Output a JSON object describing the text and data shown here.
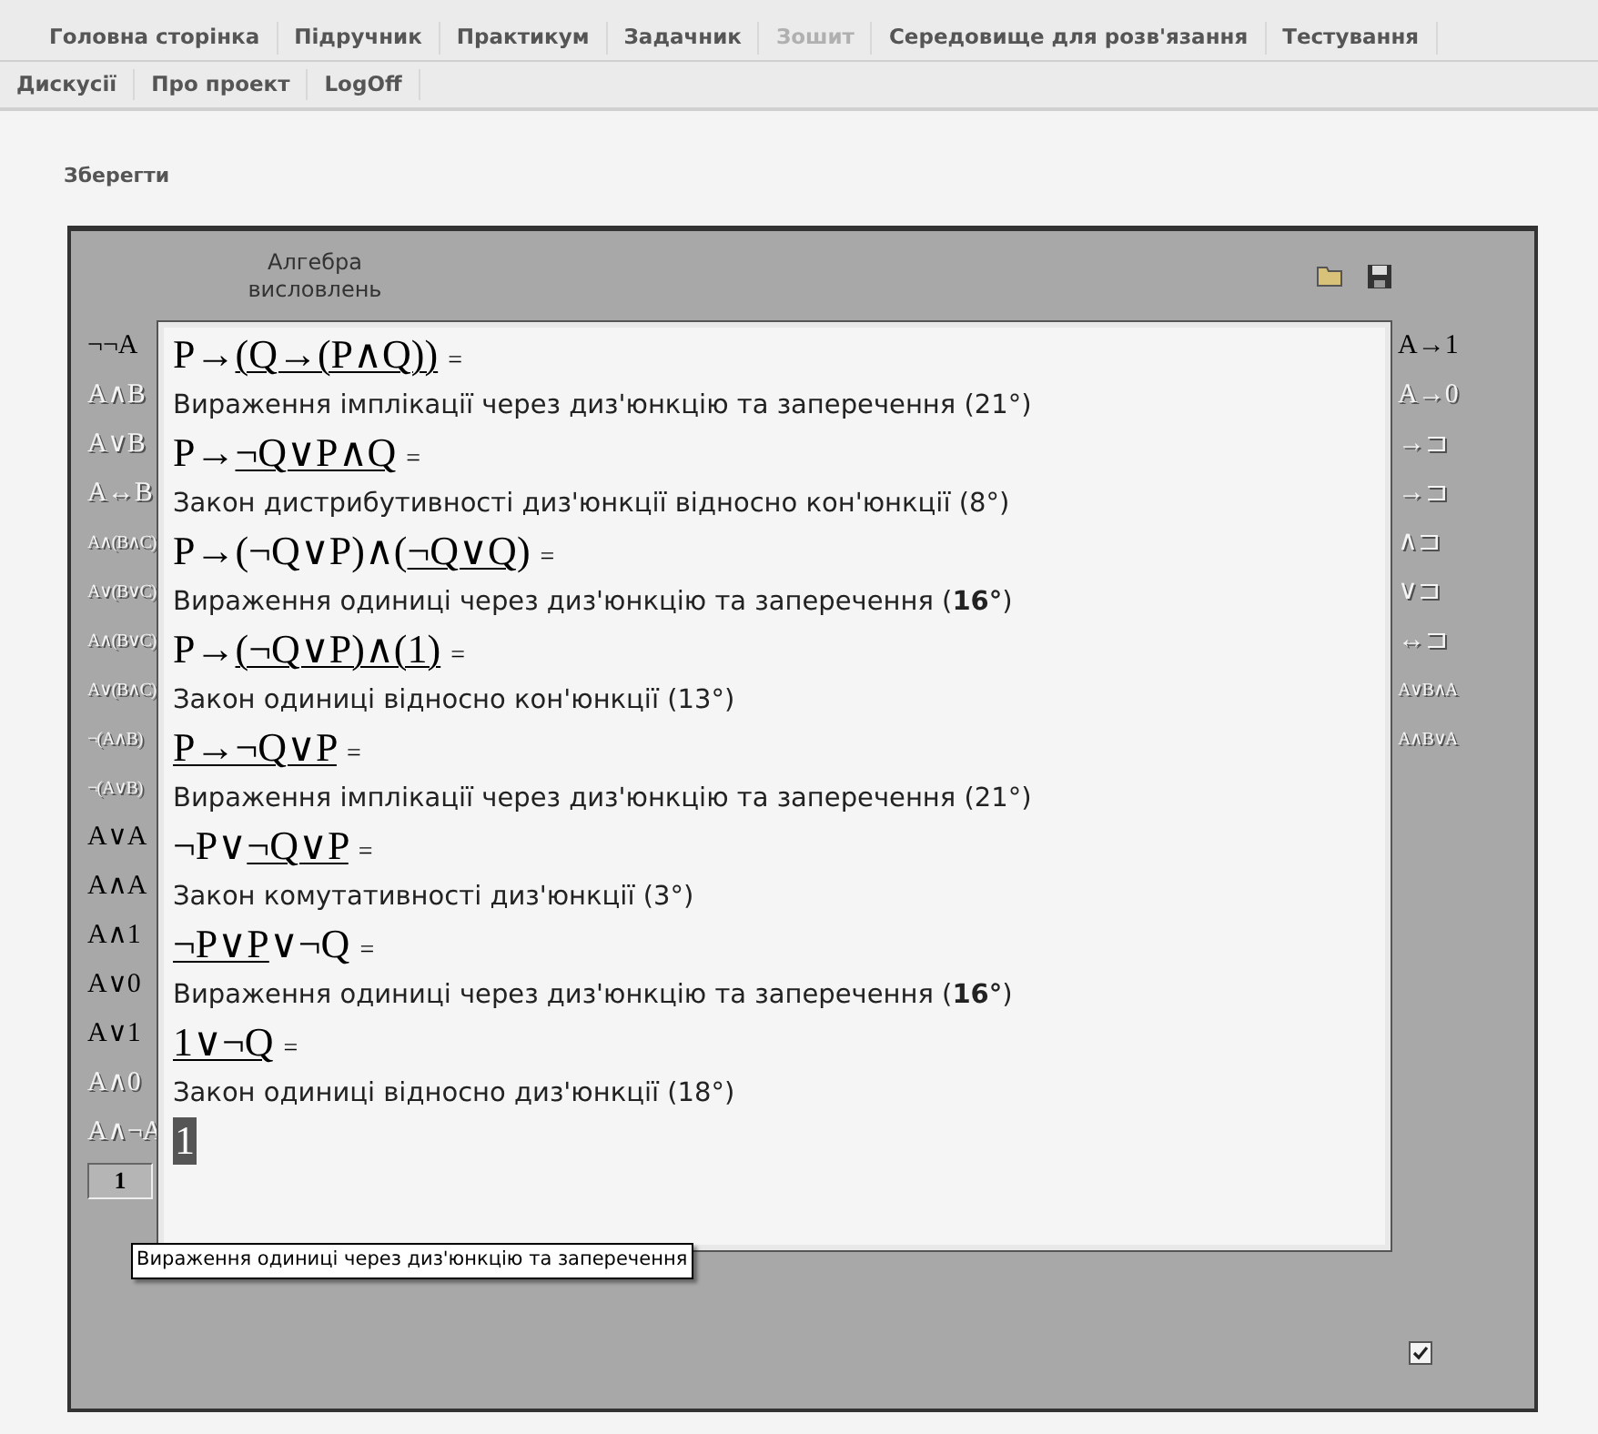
{
  "nav": {
    "main_tabs": [
      {
        "label": "Головна сторінка",
        "disabled": false
      },
      {
        "label": "Підручник",
        "disabled": false
      },
      {
        "label": "Практикум",
        "disabled": false
      },
      {
        "label": "Задачник",
        "disabled": false
      },
      {
        "label": "Зошит",
        "disabled": true
      },
      {
        "label": "Середовище для розв'язання",
        "disabled": false
      },
      {
        "label": "Тестування",
        "disabled": false
      }
    ],
    "secondary_tabs": [
      {
        "label": "Дискусії",
        "disabled": false
      },
      {
        "label": "Про проект",
        "disabled": false
      },
      {
        "label": "LogOff",
        "disabled": false
      }
    ]
  },
  "save_link": "Зберегти",
  "panel": {
    "title": "Алгебра висловлень",
    "left_buttons": [
      {
        "label": "¬¬A",
        "enabled": true
      },
      {
        "label": "A∧B",
        "enabled": false
      },
      {
        "label": "A∨B",
        "enabled": false
      },
      {
        "label": "A↔B",
        "enabled": false
      },
      {
        "label": "A∧(B∧C)",
        "enabled": false
      },
      {
        "label": "A∨(B∨C)",
        "enabled": false
      },
      {
        "label": "A∧(B∨C)",
        "enabled": false
      },
      {
        "label": "A∨(B∧C)",
        "enabled": false
      },
      {
        "label": "¬(A∧B)",
        "enabled": false
      },
      {
        "label": "¬(A∨B)",
        "enabled": false
      },
      {
        "label": "A∨A",
        "enabled": true
      },
      {
        "label": "A∧A",
        "enabled": true
      },
      {
        "label": "A∧1",
        "enabled": true
      },
      {
        "label": "A∨0",
        "enabled": true
      },
      {
        "label": "A∨1",
        "enabled": true
      },
      {
        "label": "A∧0",
        "enabled": false
      },
      {
        "label": "A∧¬A",
        "enabled": false
      }
    ],
    "left_field": {
      "value": "1"
    },
    "right_buttons": [
      {
        "label": "A→1",
        "enabled": true
      },
      {
        "label": "A→0",
        "enabled": false
      },
      {
        "label": "→⊐",
        "enabled": false
      },
      {
        "label": "→⊐",
        "enabled": false
      },
      {
        "label": "∧⊐",
        "enabled": false
      },
      {
        "label": "∨⊐",
        "enabled": false
      },
      {
        "label": "↔⊐",
        "enabled": false
      },
      {
        "label": "A∨B∧A",
        "enabled": false
      },
      {
        "label": "A∧B∨A",
        "enabled": false
      }
    ],
    "steps": [
      {
        "pre": "P→",
        "underlined": "(Q→(P∧Q))",
        "equals": "=",
        "comment": "Вираження імплікації через диз'юнкцію та заперечення (21°)"
      },
      {
        "pre": "P→",
        "underlined": "¬Q∨P∧Q",
        "equals": "=",
        "comment": "Закон дистрибутивності диз'юнкції відносно кон'юнкції (8°)"
      },
      {
        "pre": "P→(¬Q∨P)∧(",
        "underlined": "¬Q∨Q",
        "post": ")",
        "equals": "=",
        "comment": "Вираження одиниці через диз'юнкцію та заперечення (**16°**)"
      },
      {
        "pre": "P→",
        "underlined": "(¬Q∨P)∧(1)",
        "equals": "=",
        "comment": "Закон одиниці   відносно кон'юнкції (13°)"
      },
      {
        "underlined": "P→¬Q∨P",
        "equals": "=",
        "comment": "Вираження імплікації через диз'юнкцію та заперечення (21°)"
      },
      {
        "pre": "¬P∨",
        "underlined": "¬Q∨P",
        "equals": "=",
        "comment": "Закон комутативності диз'юнкції (3°)"
      },
      {
        "underlined": "¬P∨P",
        "post": "∨¬Q",
        "equals": "=",
        "comment": "Вираження одиниці через диз'юнкцію та заперечення (**16°**)"
      },
      {
        "underlined": "1∨¬Q",
        "equals": "=",
        "comment": "Закон одиниці відносно диз'юнкції (18°)"
      }
    ],
    "result": {
      "value": "1",
      "selected": true
    },
    "tooltip": "Вираження одиниці через диз'юнкцію та заперечення",
    "checkbox": {
      "checked": true
    }
  }
}
